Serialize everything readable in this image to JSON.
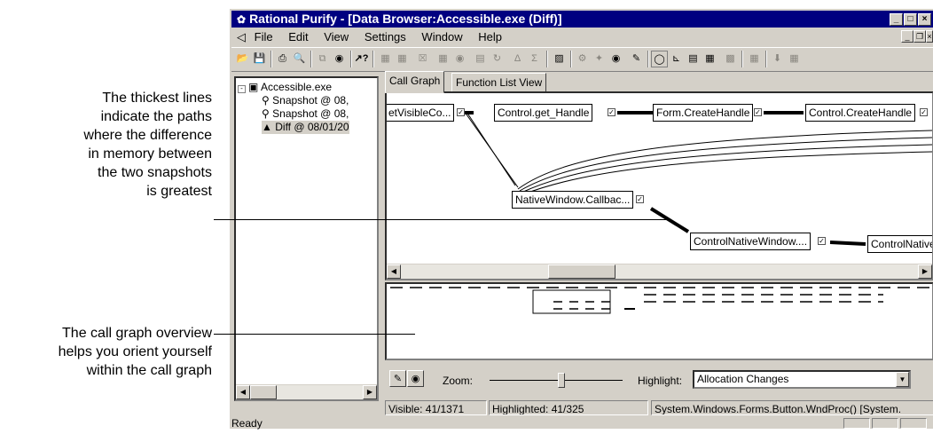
{
  "annotations": {
    "top": [
      "The thickest lines",
      "indicate the paths",
      "where the difference",
      "in memory between",
      "the two snapshots",
      "is greatest"
    ],
    "bottom": [
      "The call graph overview",
      "helps you orient yourself",
      "within the call graph"
    ]
  },
  "window": {
    "title": "Rational Purify - [Data Browser:Accessible.exe (Diff)]",
    "menu": [
      "File",
      "Edit",
      "View",
      "Settings",
      "Window",
      "Help"
    ]
  },
  "tree": {
    "items": [
      {
        "label": "Accessible.exe",
        "icon": "window-icon"
      },
      {
        "label": "Snapshot @ 08,",
        "icon": "camera-icon"
      },
      {
        "label": "Snapshot @ 08,",
        "icon": "camera-icon"
      },
      {
        "label": "Diff @ 08/01/20",
        "icon": "diff-icon"
      }
    ]
  },
  "tabs": [
    {
      "label": "Call Graph",
      "active": true
    },
    {
      "label": "Function List View",
      "active": false
    }
  ],
  "graph": {
    "nodes": [
      {
        "label": "etVisibleCo..."
      },
      {
        "label": "Control.get_Handle"
      },
      {
        "label": "Form.CreateHandle"
      },
      {
        "label": "Control.CreateHandle"
      },
      {
        "label": "NativeWindow.Callbac..."
      },
      {
        "label": "ControlNativeWindow...."
      },
      {
        "label": "ControlNative"
      }
    ]
  },
  "controls": {
    "zoom_label": "Zoom:",
    "zoom_level": 0.5,
    "highlight_label": "Highlight:",
    "highlight_value": "Allocation Changes"
  },
  "status": {
    "visible": "Visible: 41/1371",
    "highlighted": "Highlighted: 41/325",
    "method": "System.Windows.Forms.Button.WndProc() [System.",
    "ready": "Ready"
  }
}
